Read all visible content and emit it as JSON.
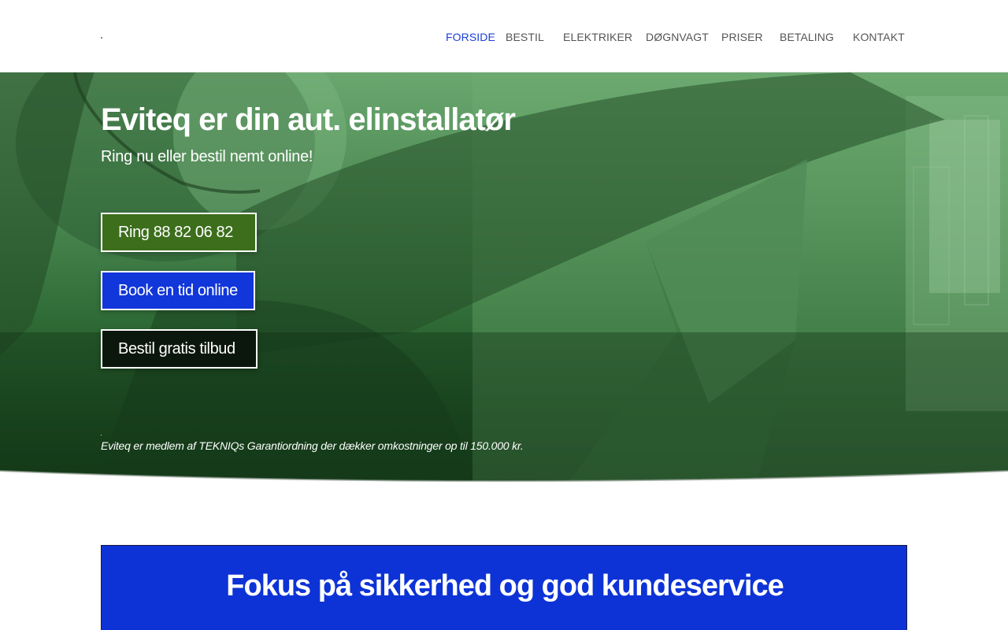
{
  "nav": {
    "items": [
      {
        "label": "FORSIDE",
        "active": true
      },
      {
        "label": "BESTIL",
        "active": false
      },
      {
        "label": "ELEKTRIKER",
        "active": false
      },
      {
        "label": "DØGNVAGT",
        "active": false
      },
      {
        "label": "PRISER",
        "active": false
      },
      {
        "label": "BETALING",
        "active": false
      },
      {
        "label": "KONTAKT",
        "active": false
      }
    ]
  },
  "hero": {
    "title": "Eviteq er din aut. elinstallatør",
    "subtitle": "Ring nu eller bestil nemt online!",
    "call_button": "Ring 88 82 06 82",
    "book_button": "Book en tid online",
    "quote_button": "Bestil gratis tilbud",
    "note": "Eviteq er medlem af TEKNIQs Garantiordning der dækker omkostninger op til 150.000 kr."
  },
  "panel": {
    "title": "Fokus på sikkerhed og god kundeservice"
  },
  "colors": {
    "accent": "#1b3fd6",
    "call_button": "#3c6e1c",
    "book_button": "#1136d9",
    "quote_button": "#0b170c",
    "panel": "#0d33d6"
  }
}
